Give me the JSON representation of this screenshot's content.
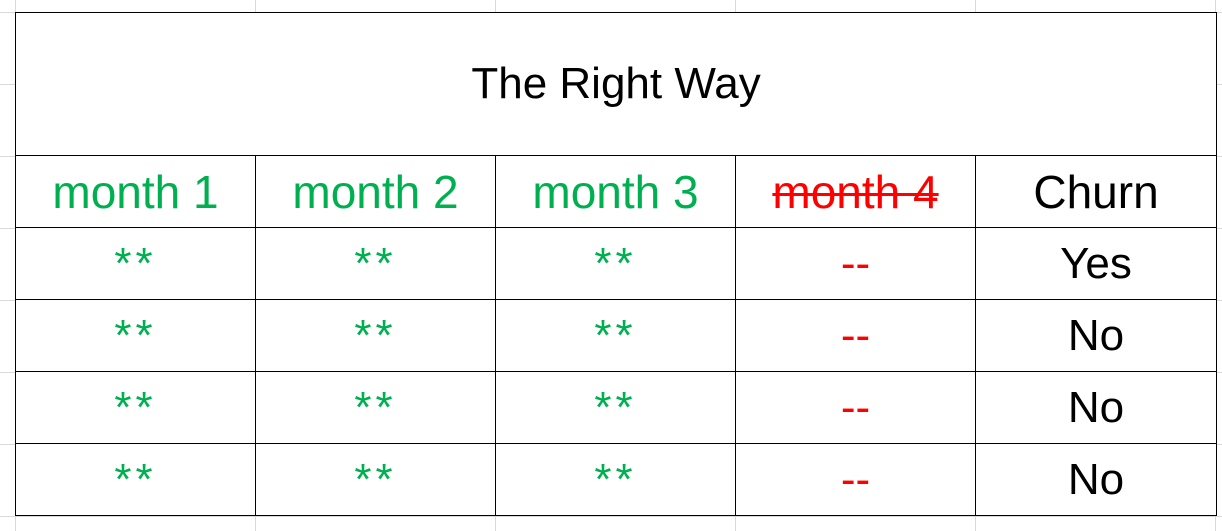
{
  "title": "The Right Way",
  "headers": {
    "month1": "month 1",
    "month2": "month 2",
    "month3": "month 3",
    "month4": "month 4",
    "churn": "Churn"
  },
  "rows": [
    {
      "m1": "**",
      "m2": "**",
      "m3": "**",
      "m4": "--",
      "churn": "Yes"
    },
    {
      "m1": "**",
      "m2": "**",
      "m3": "**",
      "m4": "--",
      "churn": "No"
    },
    {
      "m1": "**",
      "m2": "**",
      "m3": "**",
      "m4": "--",
      "churn": "No"
    },
    {
      "m1": "**",
      "m2": "**",
      "m3": "**",
      "m4": "--",
      "churn": "No"
    }
  ],
  "colors": {
    "available_month": "#00b050",
    "excluded_month": "#ff0000",
    "text": "#000000",
    "gridline": "#d9d9d9"
  }
}
